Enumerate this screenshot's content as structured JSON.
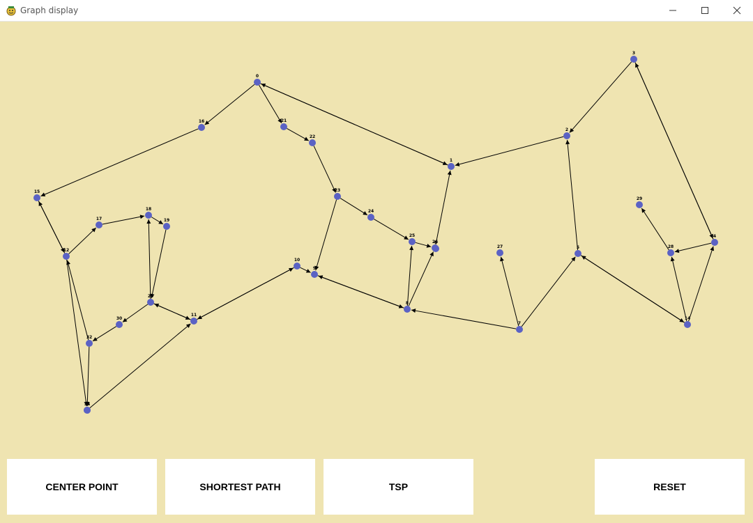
{
  "window": {
    "title": "Graph display",
    "minimize_icon": "minimize-icon",
    "maximize_icon": "maximize-icon",
    "close_icon": "close-icon",
    "app_icon": "pygame-icon"
  },
  "colors": {
    "background": "#efe4b1",
    "node_fill": "#5b62c4",
    "edge": "#000000",
    "button_bg": "#ffffff"
  },
  "graph": {
    "nodes": [
      {
        "id": "0",
        "label": "0"
      },
      {
        "id": "1",
        "label": "1"
      },
      {
        "id": "2",
        "label": "2"
      },
      {
        "id": "3",
        "label": "3"
      },
      {
        "id": "4",
        "label": "4"
      },
      {
        "id": "5",
        "label": "5"
      },
      {
        "id": "6",
        "label": "6"
      },
      {
        "id": "7",
        "label": "7"
      },
      {
        "id": "8",
        "label": "8"
      },
      {
        "id": "9",
        "label": "9"
      },
      {
        "id": "10",
        "label": "10"
      },
      {
        "id": "11",
        "label": "11"
      },
      {
        "id": "12",
        "label": "12"
      },
      {
        "id": "13",
        "label": "13"
      },
      {
        "id": "14",
        "label": "14"
      },
      {
        "id": "15",
        "label": "15"
      },
      {
        "id": "16",
        "label": "16"
      },
      {
        "id": "17",
        "label": "17"
      },
      {
        "id": "18",
        "label": "18"
      },
      {
        "id": "19",
        "label": "19"
      },
      {
        "id": "20",
        "label": "20"
      },
      {
        "id": "21",
        "label": "21"
      },
      {
        "id": "22",
        "label": "22"
      },
      {
        "id": "23",
        "label": "23"
      },
      {
        "id": "24",
        "label": "24"
      },
      {
        "id": "25",
        "label": "25"
      },
      {
        "id": "26",
        "label": "26"
      },
      {
        "id": "27",
        "label": "27"
      },
      {
        "id": "28",
        "label": "28"
      },
      {
        "id": "29",
        "label": "29"
      },
      {
        "id": "30",
        "label": "30"
      },
      {
        "id": "31",
        "label": "31"
      },
      {
        "id": "32",
        "label": "32"
      }
    ],
    "edges": [
      [
        "0",
        "16"
      ],
      [
        "16",
        "15"
      ],
      [
        "0",
        "21"
      ],
      [
        "21",
        "22"
      ],
      [
        "22",
        "23"
      ],
      [
        "0",
        "1"
      ],
      [
        "1",
        "0"
      ],
      [
        "2",
        "1"
      ],
      [
        "3",
        "2"
      ],
      [
        "3",
        "4"
      ],
      [
        "4",
        "3"
      ],
      [
        "23",
        "9"
      ],
      [
        "23",
        "24"
      ],
      [
        "24",
        "25"
      ],
      [
        "25",
        "26"
      ],
      [
        "26",
        "1"
      ],
      [
        "8",
        "25"
      ],
      [
        "8",
        "26"
      ],
      [
        "8",
        "9"
      ],
      [
        "9",
        "8"
      ],
      [
        "10",
        "9"
      ],
      [
        "10",
        "11"
      ],
      [
        "11",
        "10"
      ],
      [
        "7",
        "8"
      ],
      [
        "7",
        "27"
      ],
      [
        "7",
        "5"
      ],
      [
        "5",
        "2"
      ],
      [
        "5",
        "14"
      ],
      [
        "14",
        "5"
      ],
      [
        "14",
        "28"
      ],
      [
        "14",
        "4"
      ],
      [
        "4",
        "28"
      ],
      [
        "28",
        "29"
      ],
      [
        "15",
        "12"
      ],
      [
        "12",
        "15"
      ],
      [
        "12",
        "13"
      ],
      [
        "12",
        "17"
      ],
      [
        "17",
        "18"
      ],
      [
        "18",
        "19"
      ],
      [
        "19",
        "20"
      ],
      [
        "20",
        "18"
      ],
      [
        "20",
        "11"
      ],
      [
        "11",
        "20"
      ],
      [
        "20",
        "30"
      ],
      [
        "30",
        "32"
      ],
      [
        "32",
        "12"
      ],
      [
        "32",
        "31"
      ],
      [
        "31",
        "11"
      ]
    ]
  },
  "buttons": {
    "center_point": "CENTER POINT",
    "shortest_path": "SHORTEST PATH",
    "tsp": "TSP",
    "reset": "RESET"
  }
}
